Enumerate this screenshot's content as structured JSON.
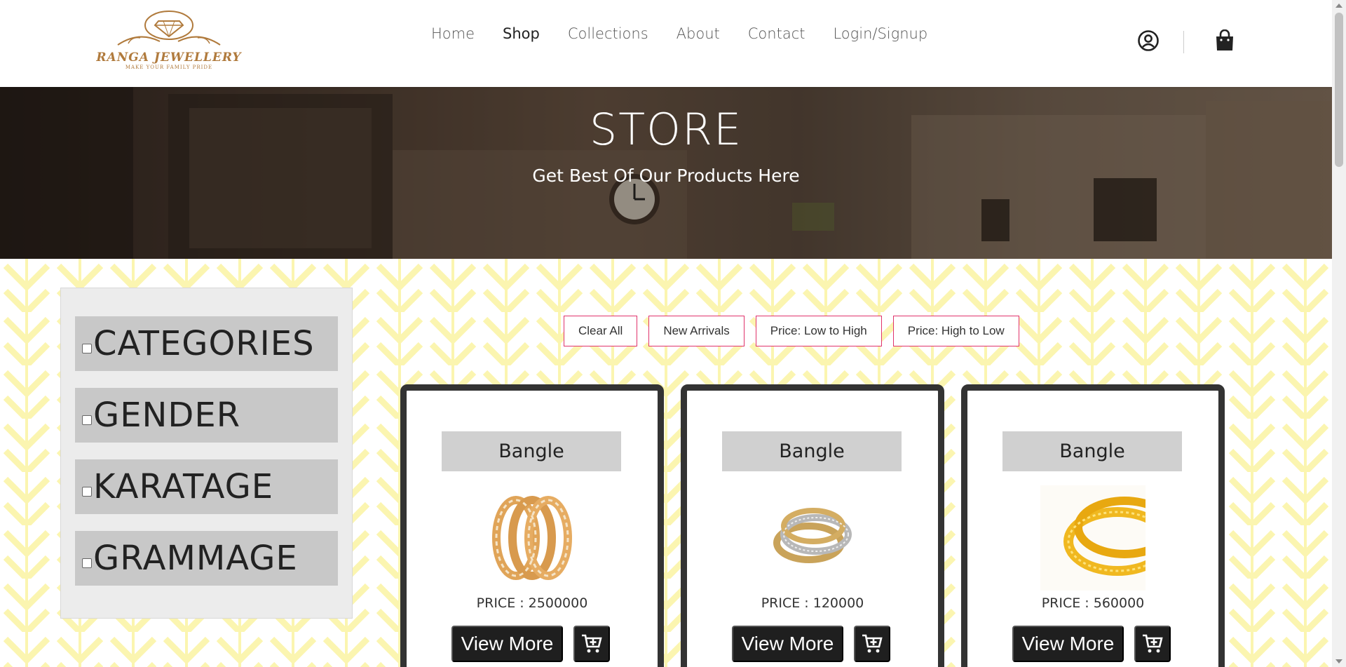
{
  "brand": {
    "name": "RANGA JEWELLERY",
    "tagline": "MAKE YOUR FAMILY PRIDE",
    "color": "#b07a3c"
  },
  "nav": {
    "items": [
      {
        "label": "Home"
      },
      {
        "label": "Shop"
      },
      {
        "label": "Collections"
      },
      {
        "label": "About"
      },
      {
        "label": "Contact"
      },
      {
        "label": "Login/Signup"
      }
    ],
    "active": "Shop"
  },
  "header_icons": [
    "user-circle-icon",
    "shopping-bag-icon"
  ],
  "hero": {
    "title": "STORE",
    "subtitle": "Get Best Of Our Products Here"
  },
  "filters": [
    {
      "label": "CATEGORIES",
      "checked": false
    },
    {
      "label": "GENDER",
      "checked": false
    },
    {
      "label": "KARATAGE",
      "checked": false
    },
    {
      "label": "GRAMMAGE",
      "checked": false
    }
  ],
  "sort_buttons": [
    {
      "label": "Clear All"
    },
    {
      "label": "New Arrivals"
    },
    {
      "label": "Price: Low to High"
    },
    {
      "label": "Price: High to Low"
    }
  ],
  "products": [
    {
      "name": "Bangle",
      "price": "PRICE : 2500000",
      "view_more": "View More",
      "icon": "add-to-cart-icon"
    },
    {
      "name": "Bangle",
      "price": "PRICE : 120000",
      "view_more": "View More",
      "icon": "add-to-cart-icon"
    },
    {
      "name": "Bangle",
      "price": "PRICE : 560000",
      "view_more": "View More",
      "icon": "add-to-cart-icon"
    }
  ],
  "colors": {
    "accent_border": "#e0336b",
    "pattern": "#fbf5b0",
    "dark_button": "#1f1f1f"
  }
}
